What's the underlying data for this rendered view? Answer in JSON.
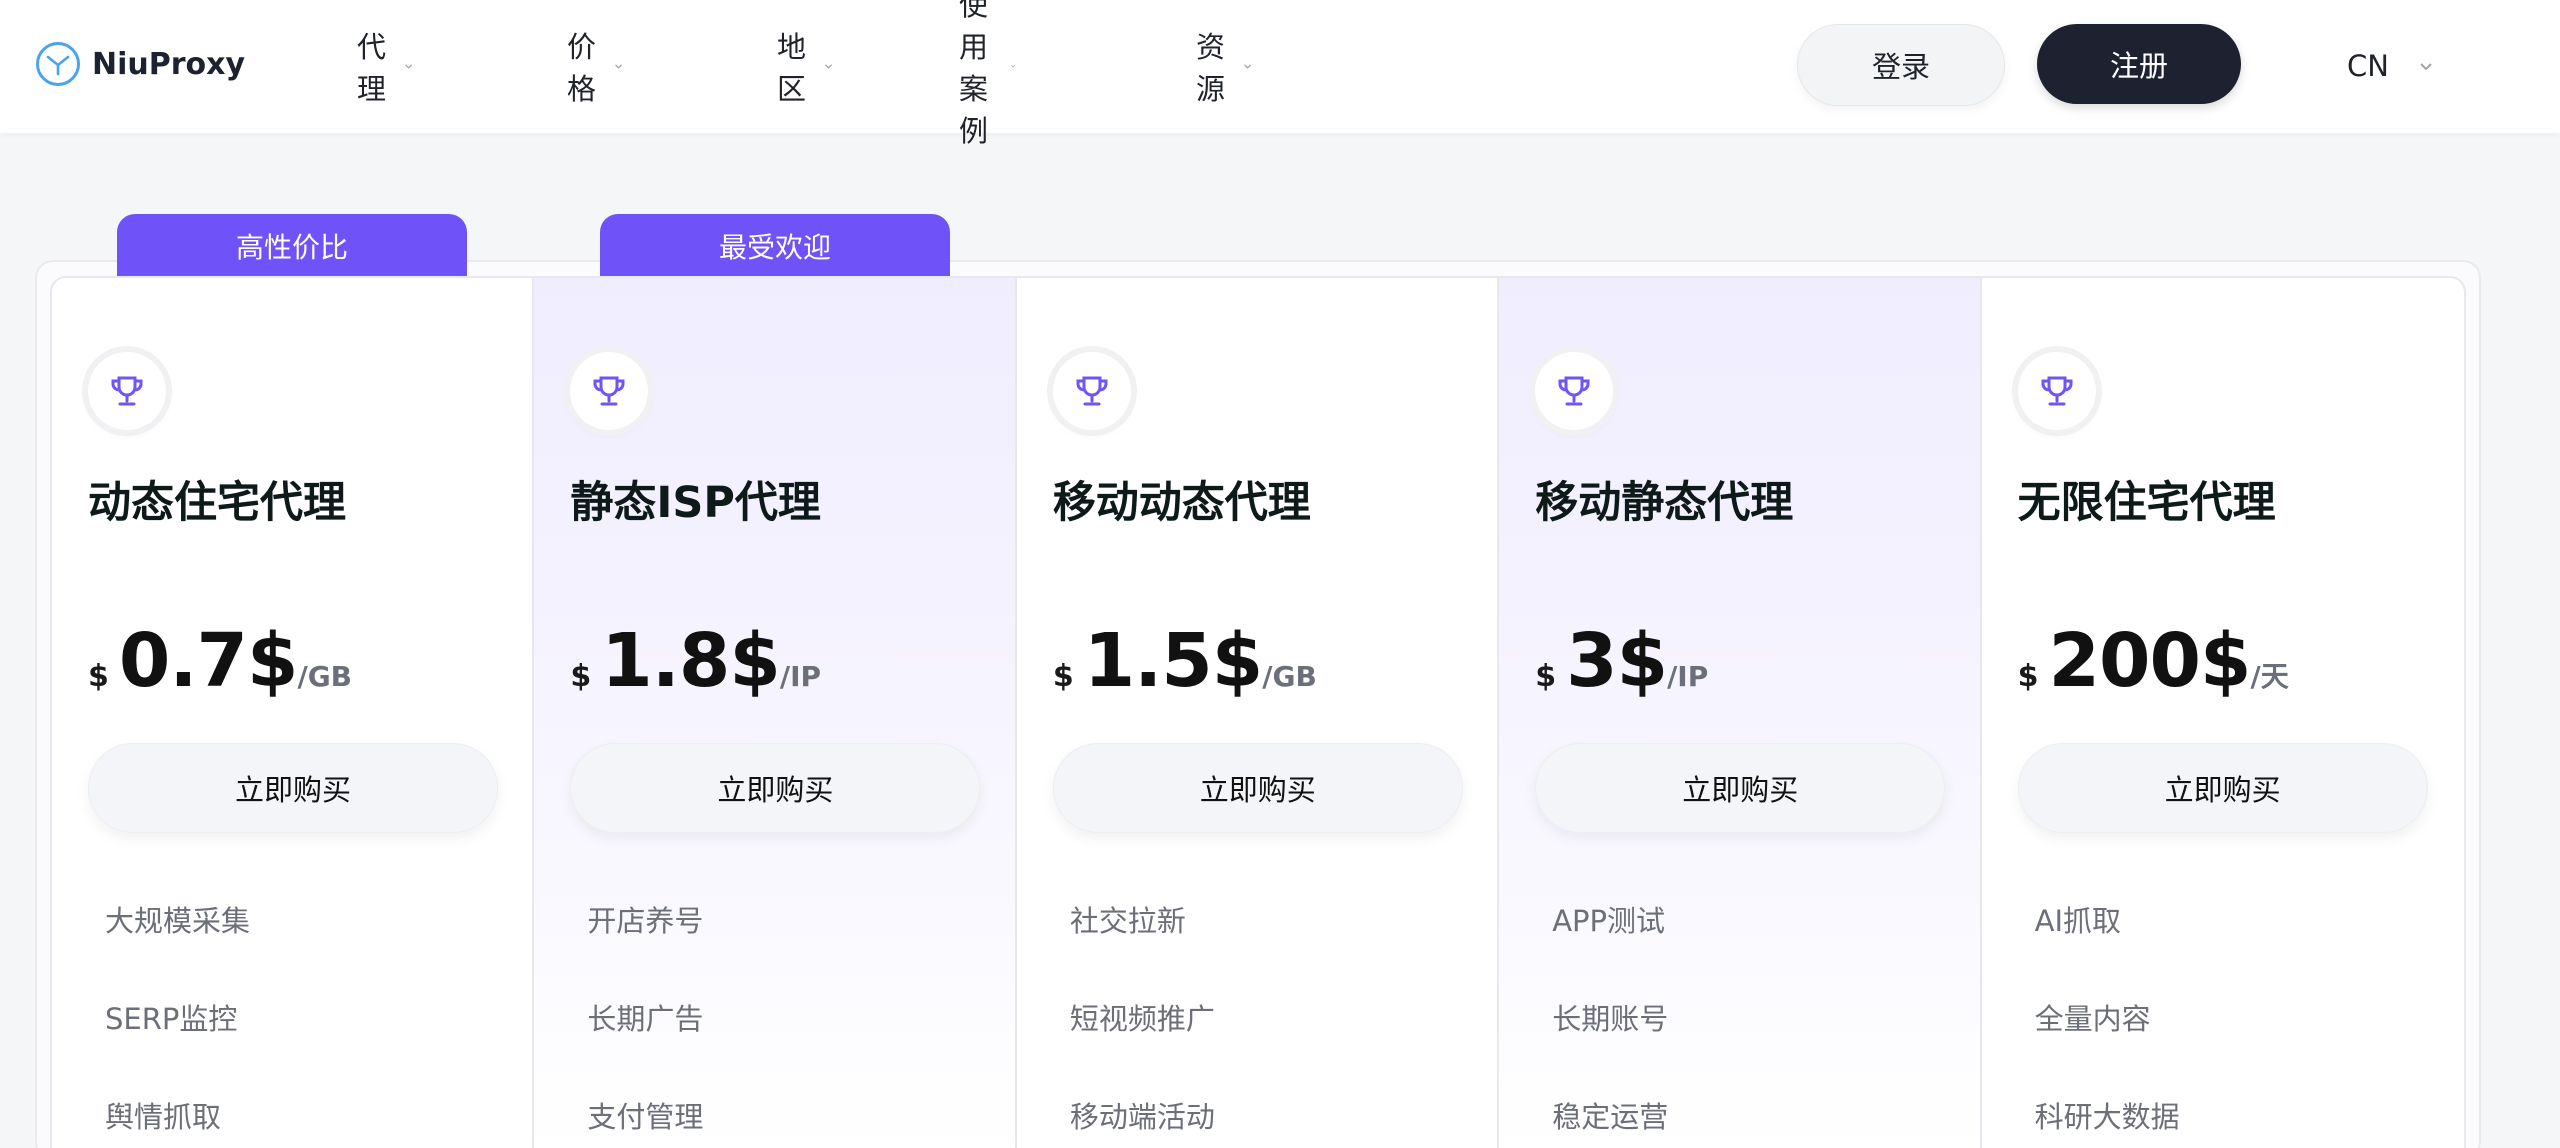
{
  "header": {
    "brand": "NiuProxy",
    "nav": [
      {
        "label": "代理"
      },
      {
        "label": "价格"
      },
      {
        "label": "地区"
      },
      {
        "label": "使用案例"
      },
      {
        "label": "资源"
      }
    ],
    "login_label": "登录",
    "register_label": "注册",
    "language": "CN"
  },
  "tags": {
    "value": "高性价比",
    "popular": "最受欢迎"
  },
  "plans": [
    {
      "title": "动态住宅代理",
      "currency": "$",
      "price": "0.7$",
      "unit": "/GB",
      "cta": "立即购买",
      "features": [
        "大规模采集",
        "SERP监控",
        "舆情抓取"
      ]
    },
    {
      "title": "静态ISP代理",
      "currency": "$",
      "price": "1.8$",
      "unit": "/IP",
      "cta": "立即购买",
      "features": [
        "开店养号",
        "长期广告",
        "支付管理"
      ]
    },
    {
      "title": "移动动态代理",
      "currency": "$",
      "price": "1.5$",
      "unit": "/GB",
      "cta": "立即购买",
      "features": [
        "社交拉新",
        "短视频推广",
        "移动端活动"
      ]
    },
    {
      "title": "移动静态代理",
      "currency": "$",
      "price": "3$",
      "unit": "/IP",
      "cta": "立即购买",
      "features": [
        "APP测试",
        "长期账号",
        "稳定运营"
      ]
    },
    {
      "title": "无限住宅代理",
      "currency": "$",
      "price": "200$",
      "unit": "/天",
      "cta": "立即购买",
      "features": [
        "AI抓取",
        "全量内容",
        "科研大数据"
      ]
    }
  ],
  "colors": {
    "accent": "#7053f8",
    "dark_button": "#1e2130",
    "logo": "#4aa3ef"
  },
  "icons": {
    "plan_icon": "trophy-icon",
    "dropdown": "chevron-down-icon"
  }
}
